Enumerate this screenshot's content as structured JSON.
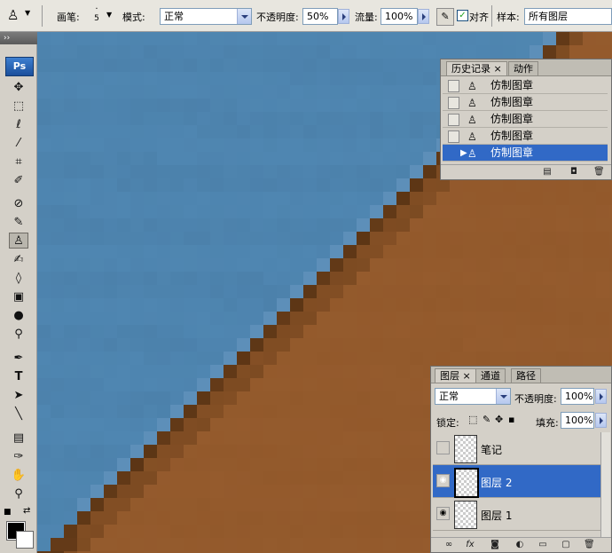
{
  "options_bar": {
    "brush_label": "画笔:",
    "brush_size": "5",
    "mode_label": "模式:",
    "mode_value": "正常",
    "opacity_label": "不透明度:",
    "opacity_value": "50%",
    "flow_label": "流量:",
    "flow_value": "100%",
    "aligned_label": "对齐",
    "aligned_checked": true,
    "sample_label": "样本:",
    "sample_value": "所有图层"
  },
  "toolbox": {
    "logo": "Ps",
    "tools": [
      "move-tool",
      "marquee-tool",
      "lasso-tool",
      "magic-wand-tool",
      "crop-tool",
      "slice-tool",
      "healing-brush-tool",
      "brush-tool",
      "clone-stamp-tool",
      "history-brush-tool",
      "eraser-tool",
      "gradient-tool",
      "blur-tool",
      "dodge-tool",
      "pen-tool",
      "type-tool",
      "path-selection-tool",
      "line-tool",
      "notes-tool",
      "eyedropper-tool",
      "hand-tool",
      "zoom-tool"
    ],
    "active_tool": "clone-stamp-tool",
    "foreground_color": "#000000",
    "background_color": "#ffffff"
  },
  "canvas": {
    "colors": {
      "blue": "#4f86b1",
      "brown": "#91582a",
      "dark": "#5a3414"
    }
  },
  "history_panel": {
    "tabs": [
      {
        "label": "历史记录"
      },
      {
        "label": "动作"
      }
    ],
    "items": [
      {
        "label": "仿制图章",
        "selected": false
      },
      {
        "label": "仿制图章",
        "selected": false
      },
      {
        "label": "仿制图章",
        "selected": false
      },
      {
        "label": "仿制图章",
        "selected": false
      },
      {
        "label": "仿制图章",
        "selected": true
      }
    ]
  },
  "layers_panel": {
    "tabs": [
      {
        "label": "图层"
      },
      {
        "label": "通道"
      },
      {
        "label": "路径"
      }
    ],
    "blend_mode": "正常",
    "opacity_label": "不透明度:",
    "opacity_value": "100%",
    "lock_label": "锁定:",
    "fill_label": "填充:",
    "fill_value": "100%",
    "layers": [
      {
        "name": "笔记",
        "visible": false,
        "selected": false
      },
      {
        "name": "图层 2",
        "visible": true,
        "selected": true
      },
      {
        "name": "图层 1",
        "visible": true,
        "selected": false
      }
    ]
  }
}
